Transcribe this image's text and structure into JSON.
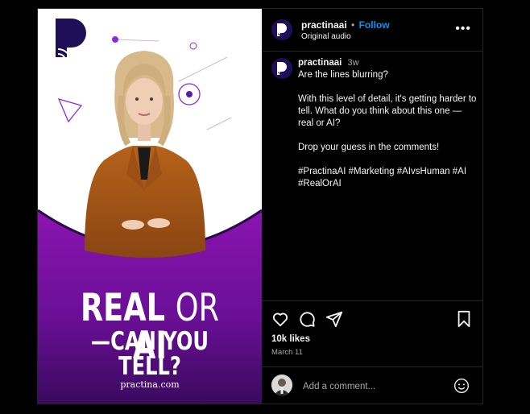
{
  "media": {
    "headline_real": "REAL",
    "headline_or": "OR",
    "headline_ai": "AI",
    "headline_line2": "—CAN YOU TELL?",
    "site": "practina.com"
  },
  "header": {
    "username": "practinaai",
    "separator": "•",
    "follow_label": "Follow",
    "audio": "Original audio",
    "more_icon": "more-horizontal-icon"
  },
  "caption": {
    "username": "practinaai",
    "time": "3w",
    "paragraphs": [
      "Are the lines blurring?",
      "With this level of detail, it's getting harder to tell. What do you think about this one —real or AI?",
      "Drop your guess in the comments!",
      "#PractinaAI #Marketing #AIvsHuman #AI #RealOrAI"
    ]
  },
  "actions": {
    "icons": [
      "heart-icon",
      "comment-icon",
      "share-icon",
      "bookmark-icon"
    ],
    "likes": "10k likes",
    "date": "March 11"
  },
  "comment": {
    "placeholder": "Add a comment...",
    "emoji_icon": "emoji-icon"
  },
  "colors": {
    "brand_purple": "#1e0f58",
    "media_purple": "#7a10a6",
    "follow_blue": "#0095f6"
  }
}
